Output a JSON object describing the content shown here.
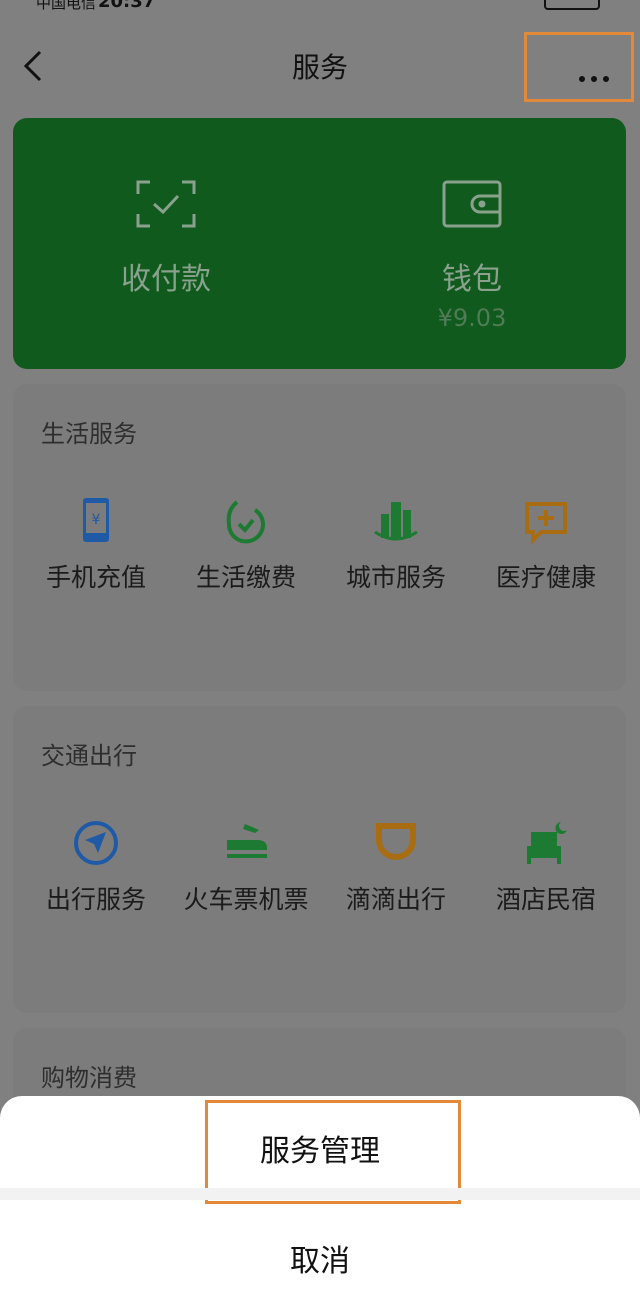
{
  "status_bar": {
    "carrier": "中国电信",
    "time": "20:37"
  },
  "header": {
    "title": "服务"
  },
  "pay_card": {
    "pay_label": "收付款",
    "wallet_label": "钱包",
    "wallet_balance": "¥9.03"
  },
  "sections": [
    {
      "title": "生活服务",
      "items": [
        {
          "label": "手机充值",
          "icon": "phone-recharge-icon"
        },
        {
          "label": "生活缴费",
          "icon": "bill-payment-icon"
        },
        {
          "label": "城市服务",
          "icon": "city-service-icon"
        },
        {
          "label": "医疗健康",
          "icon": "medical-health-icon"
        }
      ]
    },
    {
      "title": "交通出行",
      "items": [
        {
          "label": "出行服务",
          "icon": "travel-service-icon"
        },
        {
          "label": "火车票机票",
          "icon": "train-plane-ticket-icon"
        },
        {
          "label": "滴滴出行",
          "icon": "didi-icon"
        },
        {
          "label": "酒店民宿",
          "icon": "hotel-icon"
        }
      ]
    },
    {
      "title": "购物消费"
    }
  ],
  "sheet": {
    "manage_label": "服务管理",
    "cancel_label": "取消"
  },
  "colors": {
    "highlight": "#e3893a",
    "brand_green": "#07c160"
  }
}
